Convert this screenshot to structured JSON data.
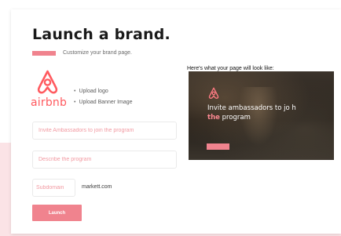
{
  "header": {
    "title": "Launch a brand.",
    "subtitle": "Customize your brand page."
  },
  "brand": {
    "logo_word": "airbnb",
    "logo_color": "#ff5a5f"
  },
  "upload": {
    "logo_label": "Upload logo",
    "banner_label": "Upload Banner Image"
  },
  "form": {
    "headline_placeholder": "Invite Ambassadors to join the program",
    "description_placeholder": "Describe the program",
    "subdomain_placeholder": "Subdomain",
    "domain_suffix": "markett.com",
    "launch_label": "Launch"
  },
  "preview": {
    "label": "Here's what your page will look like:",
    "line1": "Invite ambassadors to jo h",
    "highlight": "the",
    "line2_rest": " program"
  },
  "colors": {
    "accent": "#f0838e",
    "band": "#fbe3e6"
  },
  "icons": [
    "airbnb-logo-icon"
  ]
}
